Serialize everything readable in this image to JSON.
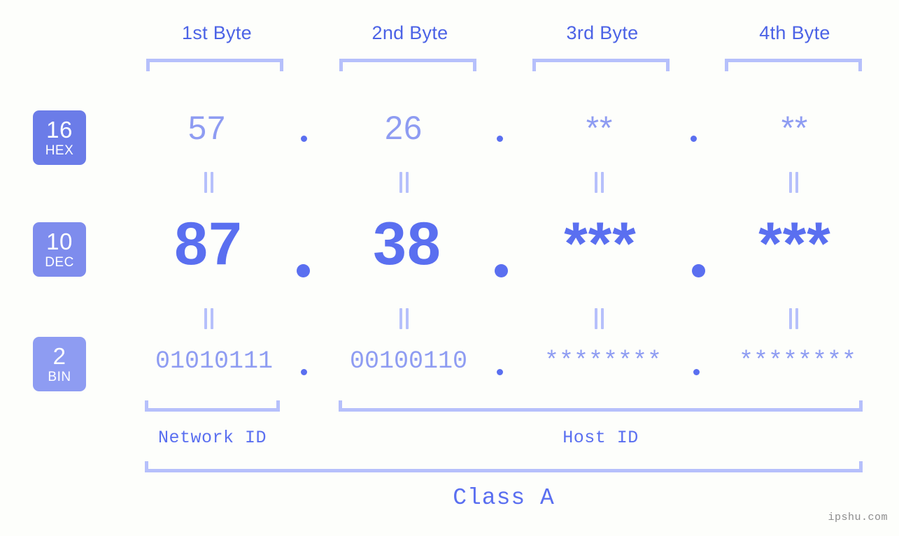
{
  "watermark": "ipshu.com",
  "byte_headers": [
    {
      "label": "1st Byte"
    },
    {
      "label": "2nd Byte"
    },
    {
      "label": "3rd Byte"
    },
    {
      "label": "4th Byte"
    }
  ],
  "bases": [
    {
      "num": "16",
      "name": "HEX",
      "color": "#6b7ce8"
    },
    {
      "num": "10",
      "name": "DEC",
      "color": "#7e8ced"
    },
    {
      "num": "2",
      "name": "BIN",
      "color": "#8e9cf2"
    }
  ],
  "rows": {
    "hex": {
      "values": [
        "57",
        "26",
        "**",
        "**"
      ]
    },
    "dec": {
      "values": [
        "87",
        "38",
        "***",
        "***"
      ]
    },
    "bin": {
      "values": [
        "01010111",
        "00100110",
        "********",
        "********"
      ]
    }
  },
  "separator": ".",
  "segments": {
    "network_id": "Network ID",
    "host_id": "Host ID",
    "class": "Class A"
  },
  "colors": {
    "background": "#fdfefb",
    "accent_strong": "#5a6ff0",
    "accent_mid": "#8e9cf2",
    "accent_light": "#b6c0fb",
    "header_text": "#4c63e6",
    "watermark_text": "#8c8c8c"
  }
}
